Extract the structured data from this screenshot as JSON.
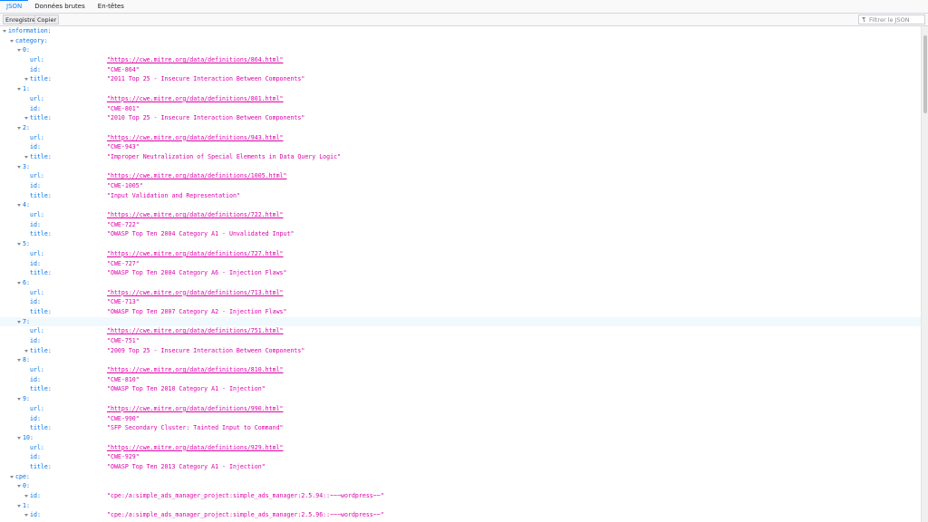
{
  "tabs": [
    "JSON",
    "Données brutes",
    "En-têtes"
  ],
  "toolbar": {
    "save_label": "Enregistrer",
    "copy_label": "Copier",
    "filter_placeholder": "Filtrer le JSON"
  },
  "tree": {
    "information_key": "information:",
    "category_key": "category:",
    "cpe_key": "cpe:",
    "field_keys": {
      "url": "url:",
      "id": "id:",
      "title": "title:"
    },
    "categories": [
      {
        "index": "0:",
        "url": "\"https://cwe.mitre.org/data/definitions/864.html\"",
        "id": "\"CWE-864\"",
        "title": "\"2011 Top 25 - Insecure Interaction Between Components\"",
        "title_expandable": true
      },
      {
        "index": "1:",
        "url": "\"https://cwe.mitre.org/data/definitions/801.html\"",
        "id": "\"CWE-801\"",
        "title": "\"2010 Top 25 - Insecure Interaction Between Components\"",
        "title_expandable": true
      },
      {
        "index": "2:",
        "url": "\"https://cwe.mitre.org/data/definitions/943.html\"",
        "id": "\"CWE-943\"",
        "title": "\"Improper Neutralization of Special Elements in Data Query Logic\"",
        "title_expandable": true
      },
      {
        "index": "3:",
        "url": "\"https://cwe.mitre.org/data/definitions/1005.html\"",
        "id": "\"CWE-1005\"",
        "title": "\"Input Validation and Representation\"",
        "title_expandable": false
      },
      {
        "index": "4:",
        "url": "\"https://cwe.mitre.org/data/definitions/722.html\"",
        "id": "\"CWE-722\"",
        "title": "\"OWASP Top Ten 2004 Category A1 - Unvalidated Input\"",
        "title_expandable": false
      },
      {
        "index": "5:",
        "url": "\"https://cwe.mitre.org/data/definitions/727.html\"",
        "id": "\"CWE-727\"",
        "title": "\"OWASP Top Ten 2004 Category A6 - Injection Flaws\"",
        "title_expandable": false
      },
      {
        "index": "6:",
        "url": "\"https://cwe.mitre.org/data/definitions/713.html\"",
        "id": "\"CWE-713\"",
        "title": "\"OWASP Top Ten 2007 Category A2 - Injection Flaws\"",
        "title_expandable": false
      },
      {
        "index": "7:",
        "url": "\"https://cwe.mitre.org/data/definitions/751.html\"",
        "id": "\"CWE-751\"",
        "title": "\"2009 Top 25 - Insecure Interaction Between Components\"",
        "title_expandable": true
      },
      {
        "index": "8:",
        "url": "\"https://cwe.mitre.org/data/definitions/810.html\"",
        "id": "\"CWE-810\"",
        "title": "\"OWASP Top Ten 2010 Category A1 - Injection\"",
        "title_expandable": false
      },
      {
        "index": "9:",
        "url": "\"https://cwe.mitre.org/data/definitions/990.html\"",
        "id": "\"CWE-990\"",
        "title": "\"SFP Secondary Cluster: Tainted Input to Command\"",
        "title_expandable": false
      },
      {
        "index": "10:",
        "url": "\"https://cwe.mitre.org/data/definitions/929.html\"",
        "id": "\"CWE-929\"",
        "title": "\"OWASP Top Ten 2013 Category A1 - Injection\"",
        "title_expandable": false
      }
    ],
    "cpe": [
      {
        "index": "0:",
        "id": "\"cpe:/a:simple_ads_manager_project:simple_ads_manager:2.5.94::~~~wordpress~~\""
      },
      {
        "index": "1:",
        "id": "\"cpe:/a:simple_ads_manager_project:simple_ads_manager:2.5.96::~~~wordpress~~\""
      }
    ]
  },
  "colors": {
    "key": "#0074e8",
    "string": "#dd00a9",
    "selected_tab": "#0a84ff",
    "hover_row": "#f0f9fe"
  }
}
